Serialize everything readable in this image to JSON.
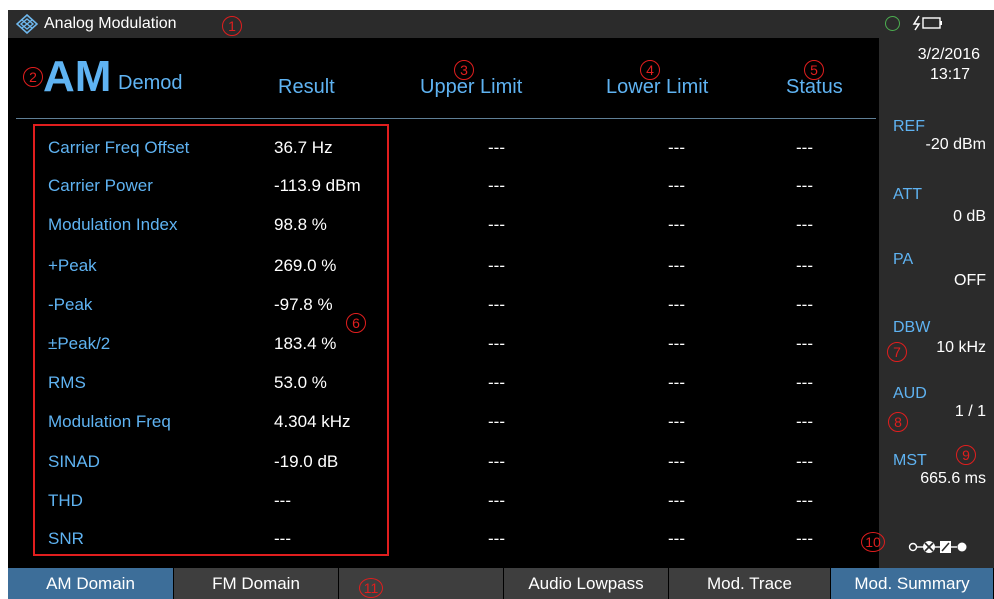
{
  "app": {
    "title": "Analog Modulation"
  },
  "header": {
    "mode": "AM",
    "mode_suffix": "Demod",
    "columns": [
      "Result",
      "Upper Limit",
      "Lower Limit",
      "Status"
    ]
  },
  "rows": [
    {
      "param": "Carrier Freq Offset",
      "result": "36.7 Hz",
      "upper": "---",
      "lower": "---",
      "status": "---"
    },
    {
      "param": "Carrier Power",
      "result": "-113.9 dBm",
      "upper": "---",
      "lower": "---",
      "status": "---"
    },
    {
      "param": "Modulation Index",
      "result": "98.8 %",
      "upper": "---",
      "lower": "---",
      "status": "---"
    },
    {
      "param": "+Peak",
      "result": "269.0 %",
      "upper": "---",
      "lower": "---",
      "status": "---"
    },
    {
      "param": "-Peak",
      "result": "-97.8 %",
      "upper": "---",
      "lower": "---",
      "status": "---"
    },
    {
      "param": "±Peak/2",
      "result": "183.4 %",
      "upper": "---",
      "lower": "---",
      "status": "---"
    },
    {
      "param": "RMS",
      "result": "53.0 %",
      "upper": "---",
      "lower": "---",
      "status": "---"
    },
    {
      "param": "Modulation Freq",
      "result": "4.304 kHz",
      "upper": "---",
      "lower": "---",
      "status": "---"
    },
    {
      "param": "SINAD",
      "result": "-19.0 dB",
      "upper": "---",
      "lower": "---",
      "status": "---"
    },
    {
      "param": "THD",
      "result": "---",
      "upper": "---",
      "lower": "---",
      "status": "---"
    },
    {
      "param": "SNR",
      "result": "---",
      "upper": "---",
      "lower": "---",
      "status": "---"
    }
  ],
  "sidebar": {
    "date": "3/2/2016",
    "time": "13:17",
    "ref": {
      "label": "REF",
      "value": "-20 dBm"
    },
    "att": {
      "label": "ATT",
      "value": "0 dB"
    },
    "pa": {
      "label": "PA",
      "value": "OFF"
    },
    "dbw": {
      "label": "DBW",
      "value": "10 kHz"
    },
    "aud": {
      "label": "AUD",
      "value": "1 / 1"
    },
    "mst": {
      "label": "MST",
      "value": "665.6 ms"
    }
  },
  "softkeys": [
    {
      "label": "AM Domain",
      "active": true
    },
    {
      "label": "FM Domain",
      "active": false
    },
    {
      "label": "",
      "active": false
    },
    {
      "label": "Audio Lowpass",
      "active": false
    },
    {
      "label": "Mod. Trace",
      "active": false
    },
    {
      "label": "Mod. Summary",
      "active": true
    }
  ],
  "callouts": [
    "1",
    "2",
    "3",
    "4",
    "5",
    "6",
    "7",
    "8",
    "9",
    "10",
    "11"
  ],
  "colors": {
    "accent": "#5fb3f2",
    "background": "#000000",
    "bar": "#2b2b2b",
    "softkey": "#3e3e3e",
    "softkey_active": "#3d6e99",
    "callout": "#e01e1e",
    "status_ok": "#4caf50"
  },
  "icons": {
    "logo": "rohde-schwarz-diamond-icon",
    "status": "status-circle-icon",
    "power": "battery-charging-icon",
    "connector": "rf-connector-icon"
  }
}
